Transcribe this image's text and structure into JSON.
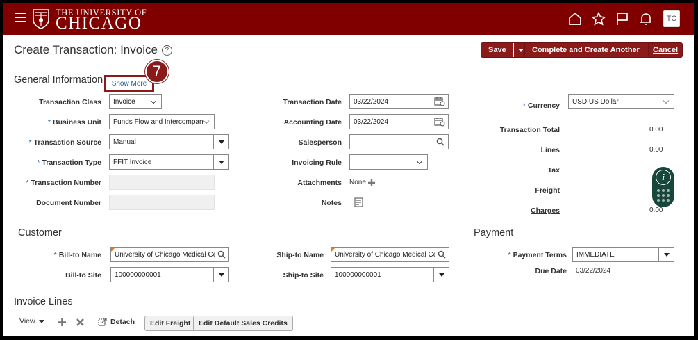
{
  "header": {
    "logo_top": "THE UNIVERSITY OF",
    "logo_main": "CHICAGO",
    "avatar_initials": "TC",
    "brand_color": "#800000",
    "icons": [
      "menu-icon",
      "home-icon",
      "star-icon",
      "flag-icon",
      "bell-icon"
    ]
  },
  "page": {
    "title": "Create Transaction: Invoice",
    "save_label": "Save",
    "complete_label": "Complete and Create Another",
    "cancel_label": "Cancel"
  },
  "general": {
    "title": "General Information",
    "show_more": "Show More",
    "step_badge": "7",
    "transaction_class_label": "Transaction Class",
    "transaction_class_value": "Invoice",
    "business_unit_label": "Business Unit",
    "business_unit_value": "Funds Flow and Intercompan",
    "transaction_source_label": "Transaction Source",
    "transaction_source_value": "Manual",
    "transaction_type_label": "Transaction Type",
    "transaction_type_value": "FFIT Invoice",
    "transaction_number_label": "Transaction Number",
    "document_number_label": "Document Number",
    "transaction_date_label": "Transaction Date",
    "transaction_date_value": "03/22/2024",
    "accounting_date_label": "Accounting Date",
    "accounting_date_value": "03/22/2024",
    "salesperson_label": "Salesperson",
    "invoicing_rule_label": "Invoicing Rule",
    "attachments_label": "Attachments",
    "attachments_value": "None",
    "notes_label": "Notes",
    "currency_label": "Currency",
    "currency_value": "USD US Dollar",
    "transaction_total_label": "Transaction Total",
    "transaction_total_value": "0.00",
    "lines_label": "Lines",
    "lines_value": "0.00",
    "tax_label": "Tax",
    "freight_label": "Freight",
    "charges_label": "Charges",
    "charges_value": "0.00"
  },
  "customer": {
    "title": "Customer",
    "bill_to_name_label": "Bill-to Name",
    "bill_to_name_value": "University of Chicago Medical Cen",
    "bill_to_site_label": "Bill-to Site",
    "bill_to_site_value": "100000000001",
    "ship_to_name_label": "Ship-to Name",
    "ship_to_name_value": "University of Chicago Medical Cen",
    "ship_to_site_label": "Ship-to Site",
    "ship_to_site_value": "100000000001"
  },
  "payment": {
    "title": "Payment",
    "payment_terms_label": "Payment Terms",
    "payment_terms_value": "IMMEDIATE",
    "due_date_label": "Due Date",
    "due_date_value": "03/22/2024"
  },
  "invoice_lines": {
    "title": "Invoice Lines",
    "view_label": "View",
    "detach_label": "Detach",
    "edit_freight_label": "Edit Freight",
    "edit_default_sales_credits_label": "Edit Default Sales Credits"
  }
}
